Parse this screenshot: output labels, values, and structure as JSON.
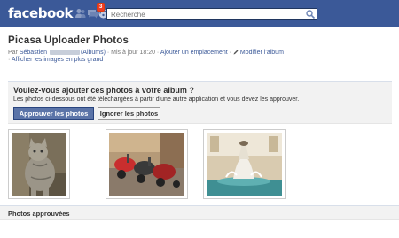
{
  "header": {
    "logo": "facebook",
    "notification_count": "3",
    "search_placeholder": "Recherche"
  },
  "album": {
    "title": "Picasa Uploader Photos",
    "by_prefix": "Par ",
    "author": "Sébastien",
    "albums_link": "(Albums)",
    "updated": " · Mis à jour 18:20 · ",
    "add_location": "Ajouter un emplacement",
    "dot_separator": " · ",
    "edit_album": "Modifier l’album",
    "bullet": "· ",
    "view_larger": "Afficher les images en plus grand"
  },
  "approval": {
    "question": "Voulez-vous ajouter ces photos à votre album ?",
    "description": "Les photos ci-dessous ont été téléchargées à partir d’une autre application et vous devez les approuver.",
    "approve_label": "Approuver les photos",
    "ignore_label": "Ignorer les photos"
  },
  "photos": [
    {
      "subject": "cat"
    },
    {
      "subject": "scooters"
    },
    {
      "subject": "fountain"
    }
  ],
  "approved_section": {
    "label": "Photos approuvées"
  },
  "colors": {
    "brand": "#3b5998",
    "badge": "#f03d25",
    "primary_button": "#5b74a8"
  }
}
